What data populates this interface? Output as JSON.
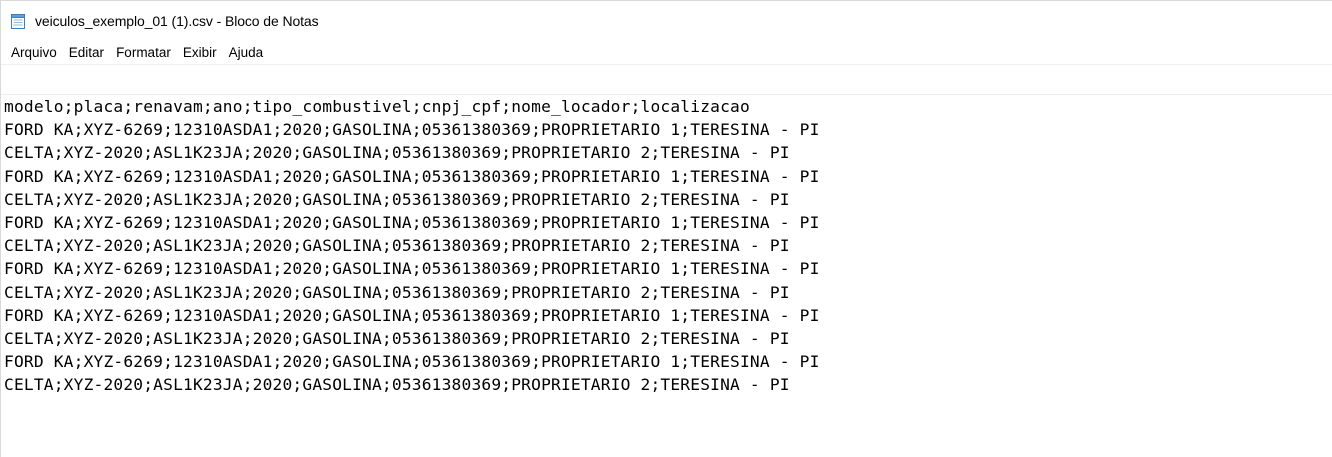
{
  "window": {
    "title": "veiculos_exemplo_01 (1).csv - Bloco de Notas",
    "icon": "notepad-icon"
  },
  "menu": {
    "items": [
      "Arquivo",
      "Editar",
      "Formatar",
      "Exibir",
      "Ajuda"
    ]
  },
  "document": {
    "lines": [
      "modelo;placa;renavam;ano;tipo_combustivel;cnpj_cpf;nome_locador;localizacao",
      "FORD KA;XYZ-6269;12310ASDA1;2020;GASOLINA;05361380369;PROPRIETARIO 1;TERESINA - PI",
      "CELTA;XYZ-2020;ASL1K23JA;2020;GASOLINA;05361380369;PROPRIETARIO 2;TERESINA - PI",
      "FORD KA;XYZ-6269;12310ASDA1;2020;GASOLINA;05361380369;PROPRIETARIO 1;TERESINA - PI",
      "CELTA;XYZ-2020;ASL1K23JA;2020;GASOLINA;05361380369;PROPRIETARIO 2;TERESINA - PI",
      "FORD KA;XYZ-6269;12310ASDA1;2020;GASOLINA;05361380369;PROPRIETARIO 1;TERESINA - PI",
      "CELTA;XYZ-2020;ASL1K23JA;2020;GASOLINA;05361380369;PROPRIETARIO 2;TERESINA - PI",
      "FORD KA;XYZ-6269;12310ASDA1;2020;GASOLINA;05361380369;PROPRIETARIO 1;TERESINA - PI",
      "CELTA;XYZ-2020;ASL1K23JA;2020;GASOLINA;05361380369;PROPRIETARIO 2;TERESINA - PI",
      "FORD KA;XYZ-6269;12310ASDA1;2020;GASOLINA;05361380369;PROPRIETARIO 1;TERESINA - PI",
      "CELTA;XYZ-2020;ASL1K23JA;2020;GASOLINA;05361380369;PROPRIETARIO 2;TERESINA - PI",
      "FORD KA;XYZ-6269;12310ASDA1;2020;GASOLINA;05361380369;PROPRIETARIO 1;TERESINA - PI",
      "CELTA;XYZ-2020;ASL1K23JA;2020;GASOLINA;05361380369;PROPRIETARIO 2;TERESINA - PI"
    ]
  }
}
